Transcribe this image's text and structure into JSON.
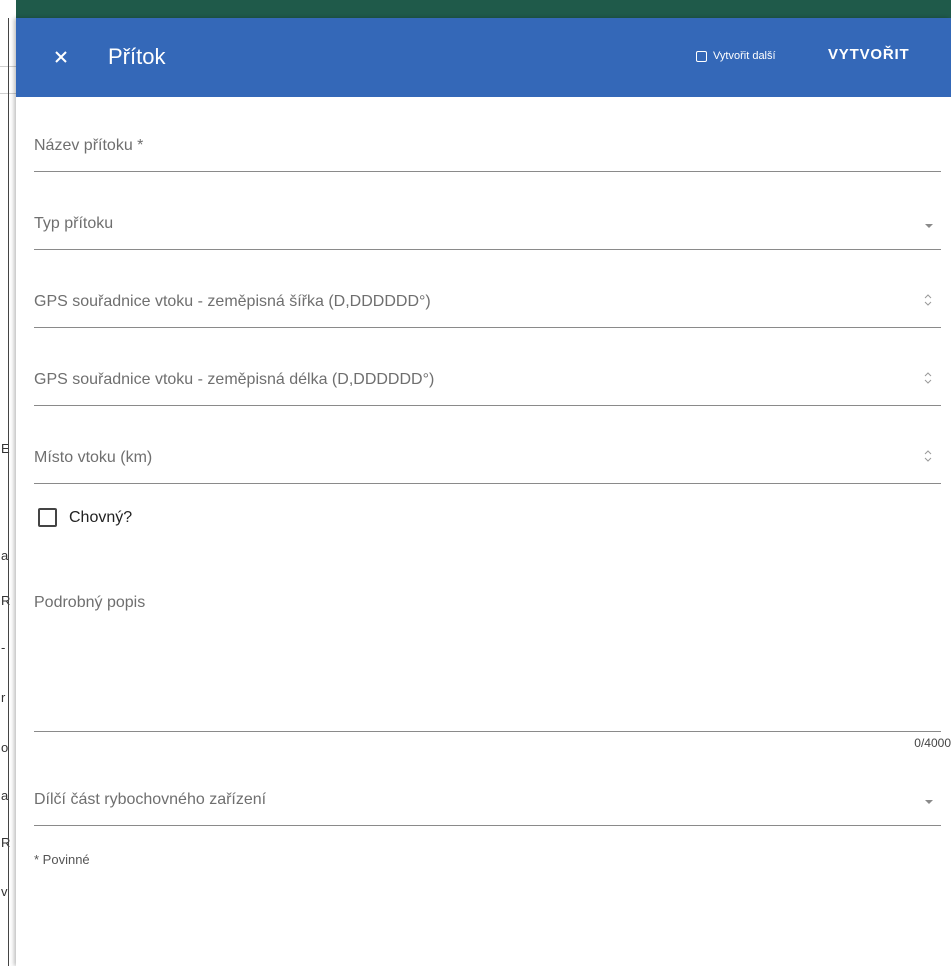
{
  "dialog": {
    "title": "Přítok",
    "create_another_label": "Vytvořit další",
    "create_another_checked": false,
    "create_button_label": "VYTVOŘIT"
  },
  "fields": {
    "name_label": "Název přítoku *",
    "type_label": "Typ přítoku",
    "gps_lat_label": "GPS souřadnice vtoku - zeměpisná šířka (D,DDDDDD°)",
    "gps_lon_label": "GPS souřadnice vtoku - zeměpisná délka (D,DDDDDD°)",
    "inflow_km_label": "Místo vtoku (km)",
    "breeding_label": "Chovný?",
    "breeding_checked": false,
    "description_label": "Podrobný popis",
    "description_counter": "0/4000",
    "facility_part_label": "Dílčí část rybochovného zařízení"
  },
  "footer": {
    "required_note": "* Povinné"
  },
  "background": {
    "fragments": [
      "E",
      "a",
      "R",
      "-",
      "r",
      "o",
      "a",
      "R",
      "v"
    ]
  },
  "colors": {
    "toolbar": "#3468b8",
    "topbar": "#1f5a4a"
  }
}
